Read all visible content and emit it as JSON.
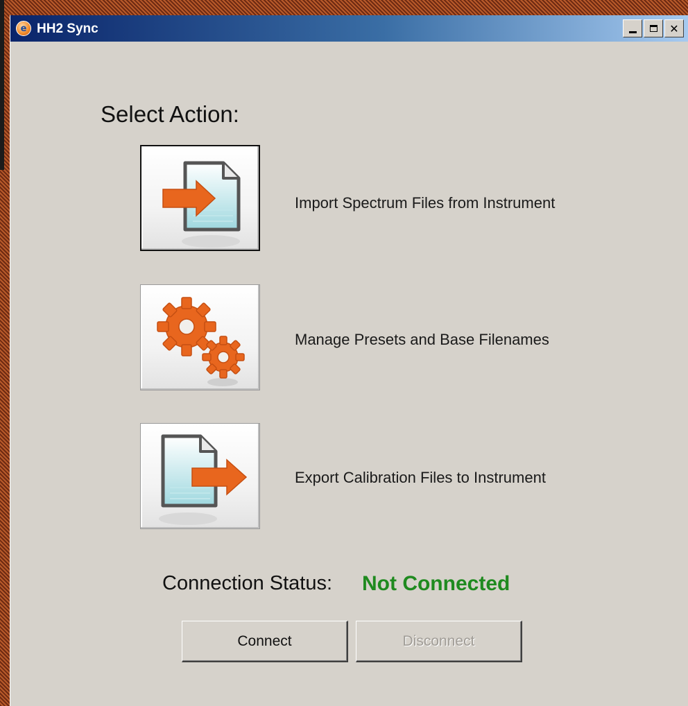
{
  "window": {
    "title": "HH2 Sync",
    "app_icon_letter": "e",
    "controls": {
      "minimize": "",
      "maximize": "",
      "close": "✕"
    }
  },
  "main": {
    "select_label": "Select Action:",
    "actions": [
      {
        "label": "Import Spectrum Files from Instrument",
        "icon": "import-file-icon",
        "selected": true
      },
      {
        "label": "Manage Presets and Base Filenames",
        "icon": "gears-icon",
        "selected": false
      },
      {
        "label": "Export Calibration Files to Instrument",
        "icon": "export-file-icon",
        "selected": false
      }
    ]
  },
  "status": {
    "label": "Connection Status:",
    "value": "Not Connected",
    "value_color": "#1f8a1f"
  },
  "buttons": {
    "connect": "Connect",
    "disconnect": "Disconnect",
    "disconnect_enabled": false
  },
  "colors": {
    "accent_orange": "#e8661e",
    "window_bg": "#d6d2cb",
    "titlebar_start": "#0a246a",
    "titlebar_end": "#a6caf0"
  }
}
